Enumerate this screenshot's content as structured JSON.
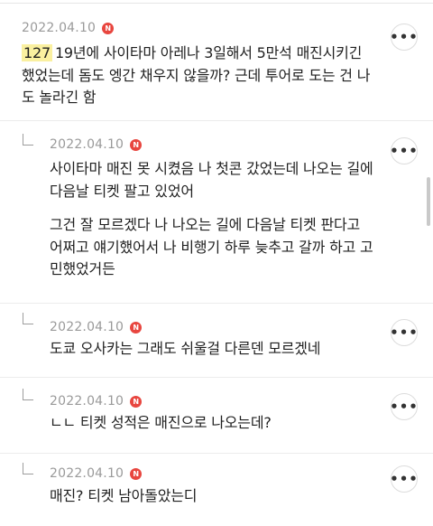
{
  "comments": [
    {
      "date": "2022.04.10",
      "badge": "N",
      "ref_number": "127",
      "lines": [
        "19년에 사이타마 아레나 3일해서 5만석 매진시키긴",
        "했었는데 돔도 엥간 채우지 않을까? 근데 투어로 도는 건 나",
        "도 놀라긴 함"
      ],
      "more_icon": "ellipsis-icon"
    }
  ],
  "replies": [
    {
      "date": "2022.04.10",
      "badge": "N",
      "paragraph1": [
        "사이타마 매진 못 시켰음 나 첫콘 갔었는데 나오는 길에",
        "다음날 티켓 팔고 있었어"
      ],
      "paragraph2": [
        "그건 잘 모르겠다 나 나오는 길에 다음날 티켓 판다고",
        "어쩌고 얘기했어서 나 비행기 하루 늦추고 갈까 하고 고",
        "민했었거든"
      ]
    },
    {
      "date": "2022.04.10",
      "badge": "N",
      "text": "도쿄 오사카는 그래도 쉬울걸 다른덴 모르겠네"
    },
    {
      "date": "2022.04.10",
      "badge": "N",
      "text": "ㄴㄴ 티켓 성적은 매진으로 나오는데?"
    },
    {
      "date": "2022.04.10",
      "badge": "N",
      "text": "매진? 티켓 남아돌았는디"
    }
  ],
  "more_label": "•••"
}
